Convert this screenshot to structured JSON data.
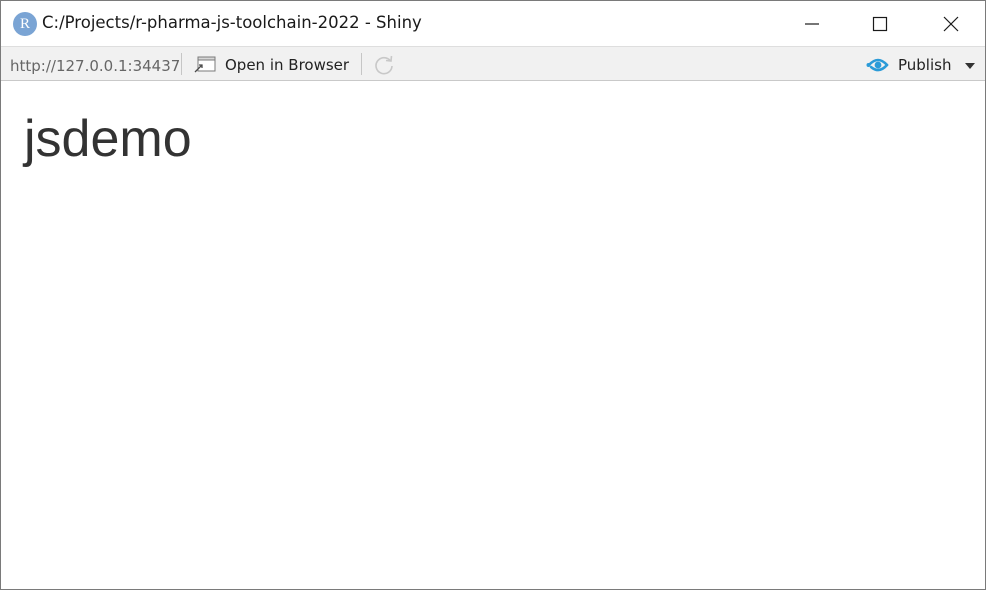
{
  "window": {
    "title": "C:/Projects/r-pharma-js-toolchain-2022 - Shiny",
    "app_icon_letter": "R",
    "app_icon_color": "#7aa4d4",
    "controls": {
      "minimize": "minimize-icon",
      "maximize": "maximize-icon",
      "close": "close-icon"
    }
  },
  "toolbar": {
    "url": "http://127.0.0.1:34437",
    "open_in_browser_label": "Open in Browser",
    "refresh_icon": "refresh-icon",
    "publish_label": "Publish",
    "publish_icon_color": "#2b9bd8"
  },
  "content": {
    "heading": "jsdemo"
  }
}
